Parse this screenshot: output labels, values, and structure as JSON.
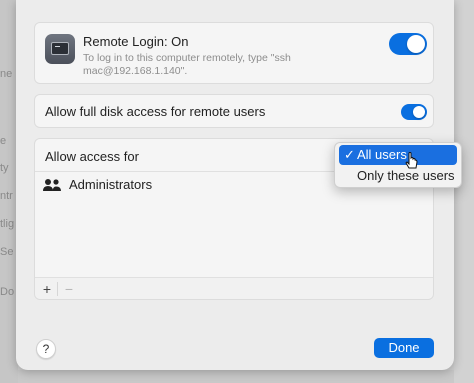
{
  "background": {
    "fragments": [
      "ne",
      "e",
      "ty",
      "ntr",
      "tlig",
      "Se",
      "Do"
    ]
  },
  "remote_login": {
    "title": "Remote Login: On",
    "subtitle": "To log in to this computer remotely, type \"ssh mac@192.168.1.140\".",
    "enabled": true,
    "icon": "terminal-screen-icon"
  },
  "full_disk_access": {
    "label": "Allow full disk access for remote users",
    "enabled": true
  },
  "access": {
    "label": "Allow access for",
    "groups": [
      {
        "label": "Administrators",
        "icon": "people-icon"
      }
    ],
    "add_label": "+",
    "remove_label": "−"
  },
  "popup_menu": {
    "options": [
      "All users",
      "Only these users"
    ],
    "selected": "All users",
    "check": "✓"
  },
  "footer": {
    "help_label": "?",
    "done_label": "Done"
  },
  "colors": {
    "accent": "#0a6fe0",
    "sheet_bg": "#ececec",
    "card_bg": "#f5f5f5"
  }
}
